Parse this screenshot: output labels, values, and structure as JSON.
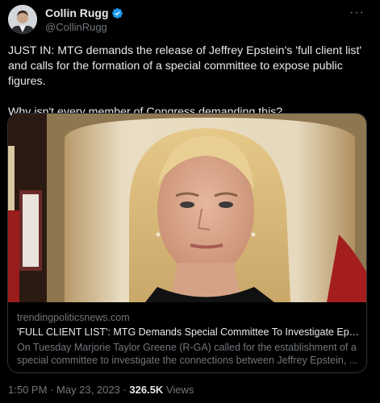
{
  "author": {
    "name": "Collin Rugg",
    "handle": "@CollinRugg",
    "verified": true
  },
  "more_icon": "more-horizontal-icon",
  "tweet": {
    "paragraph1": "JUST IN: MTG demands the release of Jeffrey Epstein's 'full client list' and calls for the formation of a special committee to expose public figures.",
    "paragraph2": "Why isn't every member of Congress demanding this?"
  },
  "card": {
    "domain": "trendingpoliticsnews.com",
    "title": "'FULL CLIENT LIST': MTG Demands Special Committee To Investigate Epstein...",
    "description": "On Tuesday Marjorie Taylor Greene (R-GA) called for the establishment of a special committee to investigate the connections between Jeffrey Epstein, ..."
  },
  "footer": {
    "time": "1:50 PM",
    "sep1": "·",
    "date": "May 23, 2023",
    "sep2": "·",
    "views_count": "326.5K",
    "views_label": "Views"
  },
  "colors": {
    "background": "#000000",
    "text": "#e7e9ea",
    "muted": "#71767b",
    "verified": "#1d9bf0",
    "border": "#2f3336"
  }
}
